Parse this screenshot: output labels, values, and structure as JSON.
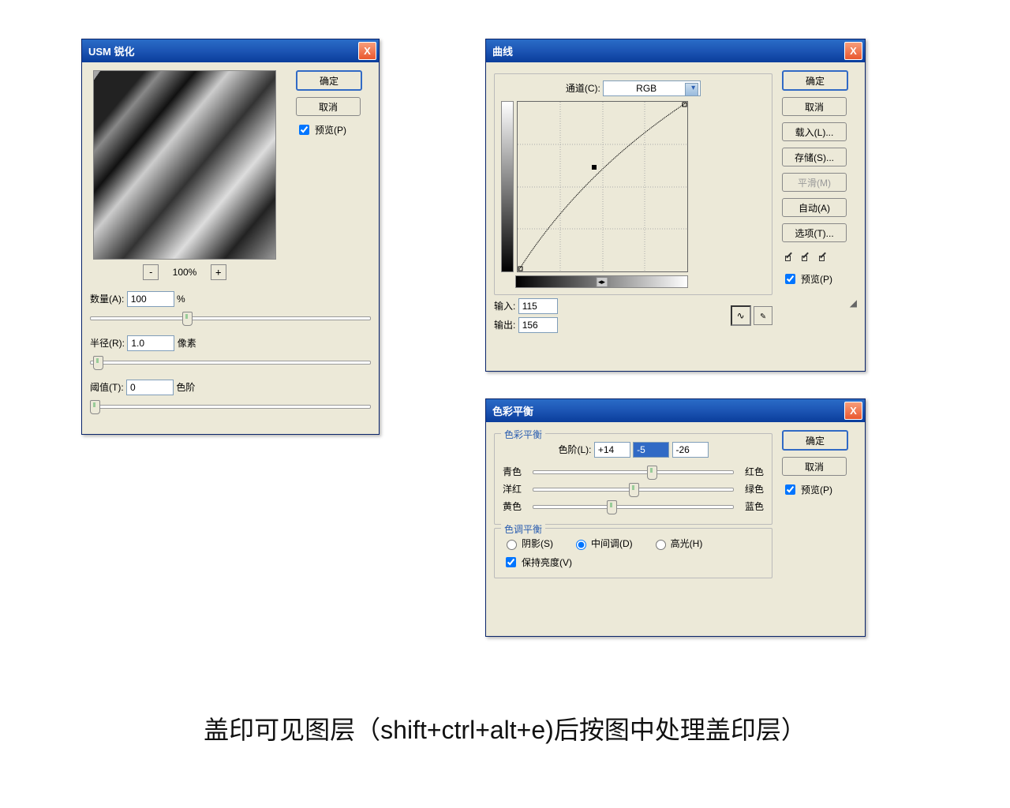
{
  "usm": {
    "title": "USM 锐化",
    "zoom": "100%",
    "ok": "确定",
    "cancel": "取消",
    "preview": "预览(P)",
    "amount_l": "数量(A):",
    "amount_v": "100",
    "amount_u": "%",
    "radius_l": "半径(R):",
    "radius_v": "1.0",
    "radius_u": "像素",
    "thresh_l": "阈值(T):",
    "thresh_v": "0",
    "thresh_u": "色阶"
  },
  "curves": {
    "title": "曲线",
    "channel_l": "通道(C):",
    "channel_v": "RGB",
    "ok": "确定",
    "cancel": "取消",
    "load": "载入(L)...",
    "save": "存储(S)...",
    "smooth": "平滑(M)",
    "auto": "自动(A)",
    "opts": "选项(T)...",
    "input_l": "输入:",
    "input_v": "115",
    "output_l": "输出:",
    "output_v": "156",
    "preview": "预览(P)"
  },
  "cb": {
    "title": "色彩平衡",
    "grp1": "色彩平衡",
    "grp2": "色调平衡",
    "levels_l": "色阶(L):",
    "l1": "+14",
    "l2": "-5",
    "l3": "-26",
    "cyan": "青色",
    "red": "红色",
    "mag": "洋红",
    "green": "绿色",
    "yel": "黄色",
    "blue": "蓝色",
    "shadows": "阴影(S)",
    "mids": "中间调(D)",
    "high": "高光(H)",
    "lum": "保持亮度(V)",
    "ok": "确定",
    "cancel": "取消",
    "preview": "预览(P)"
  },
  "caption": "盖印可见图层（shift+ctrl+alt+e)后按图中处理盖印层）"
}
